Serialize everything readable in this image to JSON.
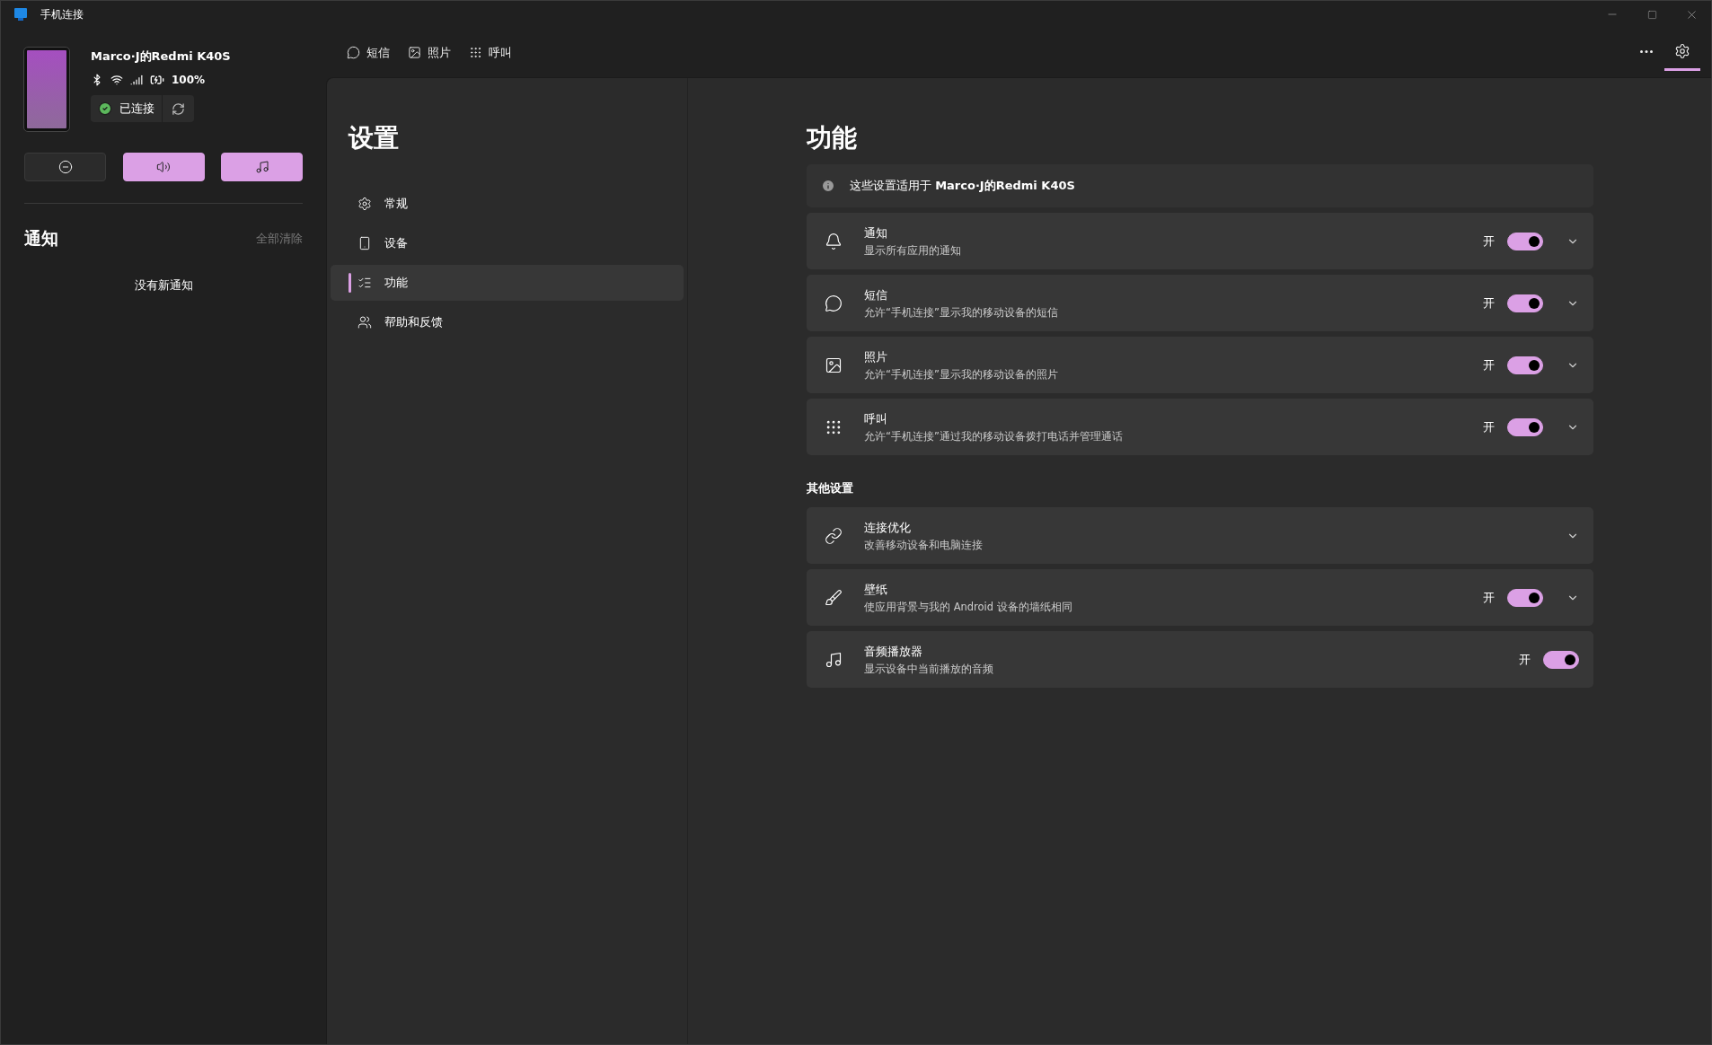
{
  "window": {
    "title": "手机连接"
  },
  "device": {
    "name": "Marco·J的Redmi K40S",
    "battery": "100%",
    "status": "已连接"
  },
  "quick_actions": [
    {
      "on": false
    },
    {
      "on": true
    },
    {
      "on": true
    }
  ],
  "notifications": {
    "title": "通知",
    "clear": "全部清除",
    "empty": "没有新通知"
  },
  "top_tabs": [
    {
      "label": "短信"
    },
    {
      "label": "照片"
    },
    {
      "label": "呼叫"
    }
  ],
  "top_actions": [
    {
      "kind": "more",
      "selected": false
    },
    {
      "kind": "settings",
      "selected": true
    }
  ],
  "settings_nav": {
    "title": "设置",
    "items": [
      {
        "label": "常规",
        "selected": false
      },
      {
        "label": "设备",
        "selected": false
      },
      {
        "label": "功能",
        "selected": true
      },
      {
        "label": "帮助和反馈",
        "selected": false
      }
    ]
  },
  "content": {
    "title": "功能",
    "info": "这些设置适用于 **Marco·J的Redmi K40S**",
    "features": [
      {
        "title": "通知",
        "desc": "显示所有应用的通知",
        "toggle": {
          "label": "开",
          "on": true
        },
        "expandable": true
      },
      {
        "title": "短信",
        "desc": "允许“手机连接”显示我的移动设备的短信",
        "toggle": {
          "label": "开",
          "on": true
        },
        "expandable": true
      },
      {
        "title": "照片",
        "desc": "允许“手机连接”显示我的移动设备的照片",
        "toggle": {
          "label": "开",
          "on": true
        },
        "expandable": true
      },
      {
        "title": "呼叫",
        "desc": "允许“手机连接”通过我的移动设备拨打电话并管理通话",
        "toggle": {
          "label": "开",
          "on": true
        },
        "expandable": true
      }
    ],
    "other_title": "其他设置",
    "other": [
      {
        "title": "连接优化",
        "desc": "改善移动设备和电脑连接",
        "expandable": true
      },
      {
        "title": "壁纸",
        "desc": "使应用背景与我的 Android 设备的墙纸相同",
        "toggle": {
          "label": "开",
          "on": true
        },
        "expandable": true
      },
      {
        "title": "音频播放器",
        "desc": "显示设备中当前播放的音频",
        "toggle": {
          "label": "开",
          "on": true
        },
        "expandable": false
      }
    ]
  }
}
